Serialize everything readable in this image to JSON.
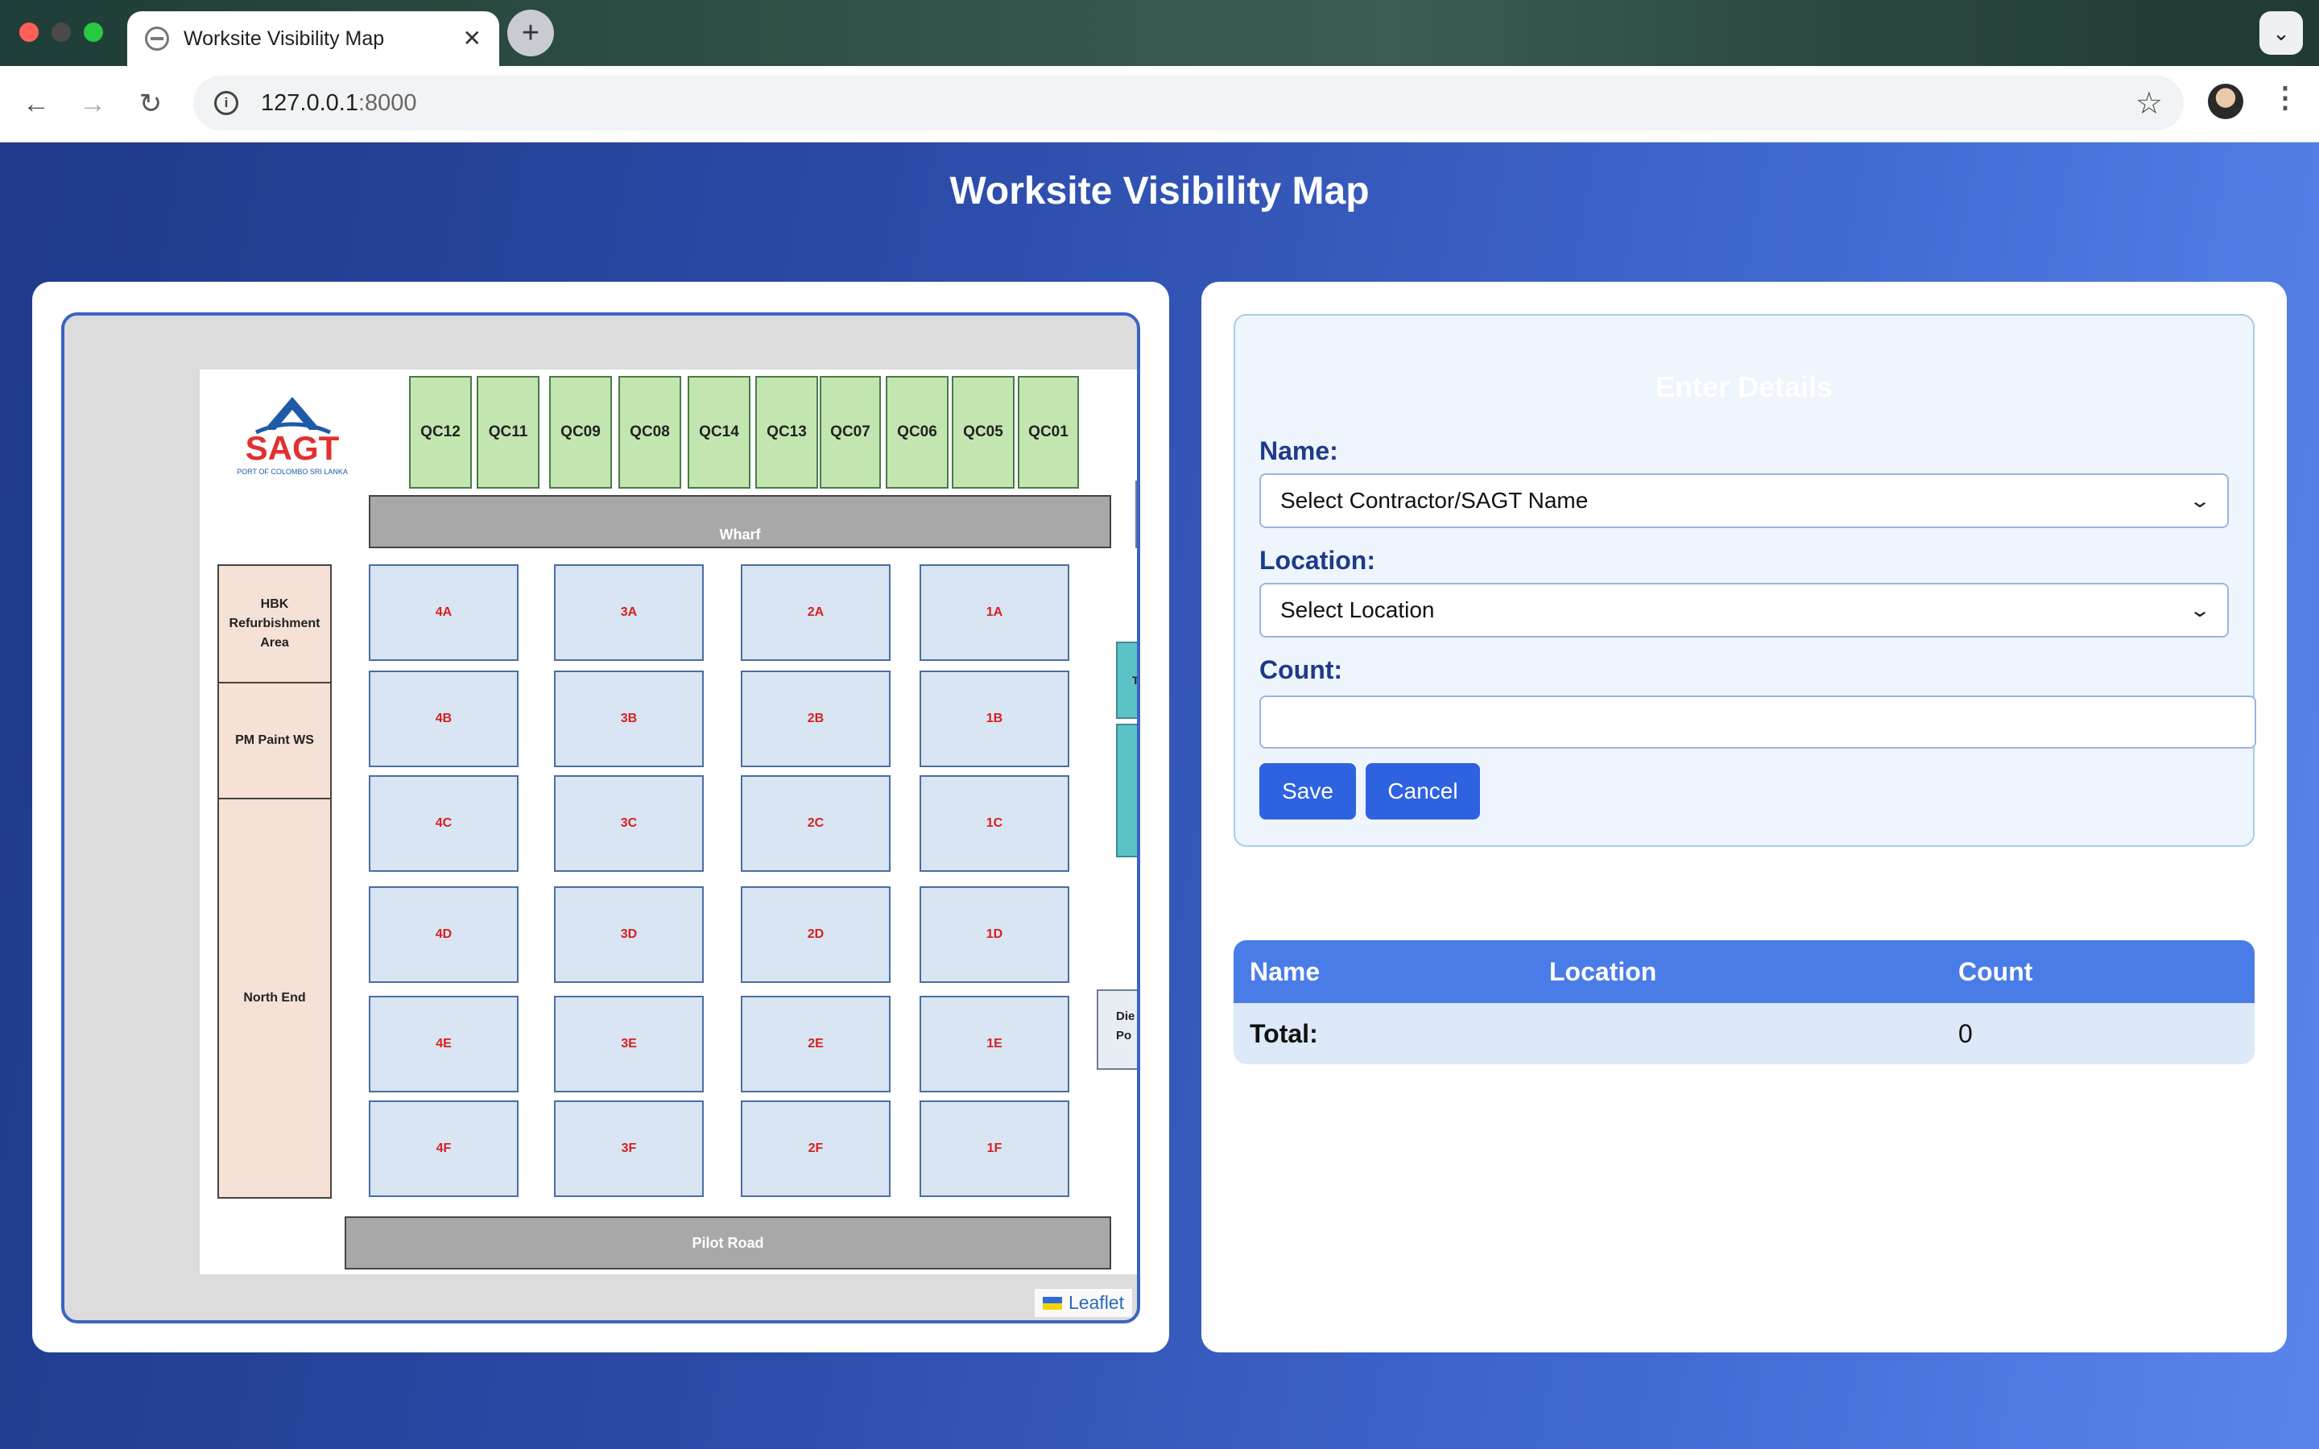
{
  "browser": {
    "tab_title": "Worksite Visibility Map",
    "tab_close": "✕",
    "new_tab": "+",
    "url_host": "127.0.0.1",
    "url_port": ":8000"
  },
  "page": {
    "title": "Worksite Visibility Map"
  },
  "map": {
    "logo_text": "SAGT",
    "logo_subtitle": "PORT OF COLOMBO SRI LANKA",
    "quay_cranes": [
      "QC12",
      "QC11",
      "QC09",
      "QC08",
      "QC14",
      "QC13",
      "QC07",
      "QC06",
      "QC05",
      "QC01"
    ],
    "wharf": "Wharf",
    "pilot_road": "Pilot Road",
    "zones": {
      "hbk": "HBK Refurbishment Area",
      "pm_paint": "PM Paint WS",
      "north_end": "North End"
    },
    "blocks": [
      [
        "4A",
        "3A",
        "2A",
        "1A"
      ],
      [
        "4B",
        "3B",
        "2B",
        "1B"
      ],
      [
        "4C",
        "3C",
        "2C",
        "1C"
      ],
      [
        "4D",
        "3D",
        "2D",
        "1D"
      ],
      [
        "4E",
        "3E",
        "2E",
        "1E"
      ],
      [
        "4F",
        "3F",
        "2F",
        "1F"
      ]
    ],
    "edge_teal_label": "T",
    "edge_box_label_1": "Die",
    "edge_box_label_2": "Po",
    "attribution": "Leaflet"
  },
  "form": {
    "heading": "Enter Details",
    "name_label": "Name:",
    "name_selected": "Select Contractor/SAGT Name",
    "location_label": "Location:",
    "location_selected": "Select Location",
    "count_label": "Count:",
    "count_value": "",
    "save_label": "Save",
    "cancel_label": "Cancel"
  },
  "table": {
    "headers": [
      "Name",
      "Location",
      "Count"
    ],
    "total_label": "Total:",
    "total_count": "0"
  },
  "colors": {
    "accent": "#2f62e0",
    "header_blue": "#4a7ce8",
    "crane_green": "#c3e6b0",
    "block_blue": "#d9e5f2",
    "block_text": "#d62020"
  }
}
